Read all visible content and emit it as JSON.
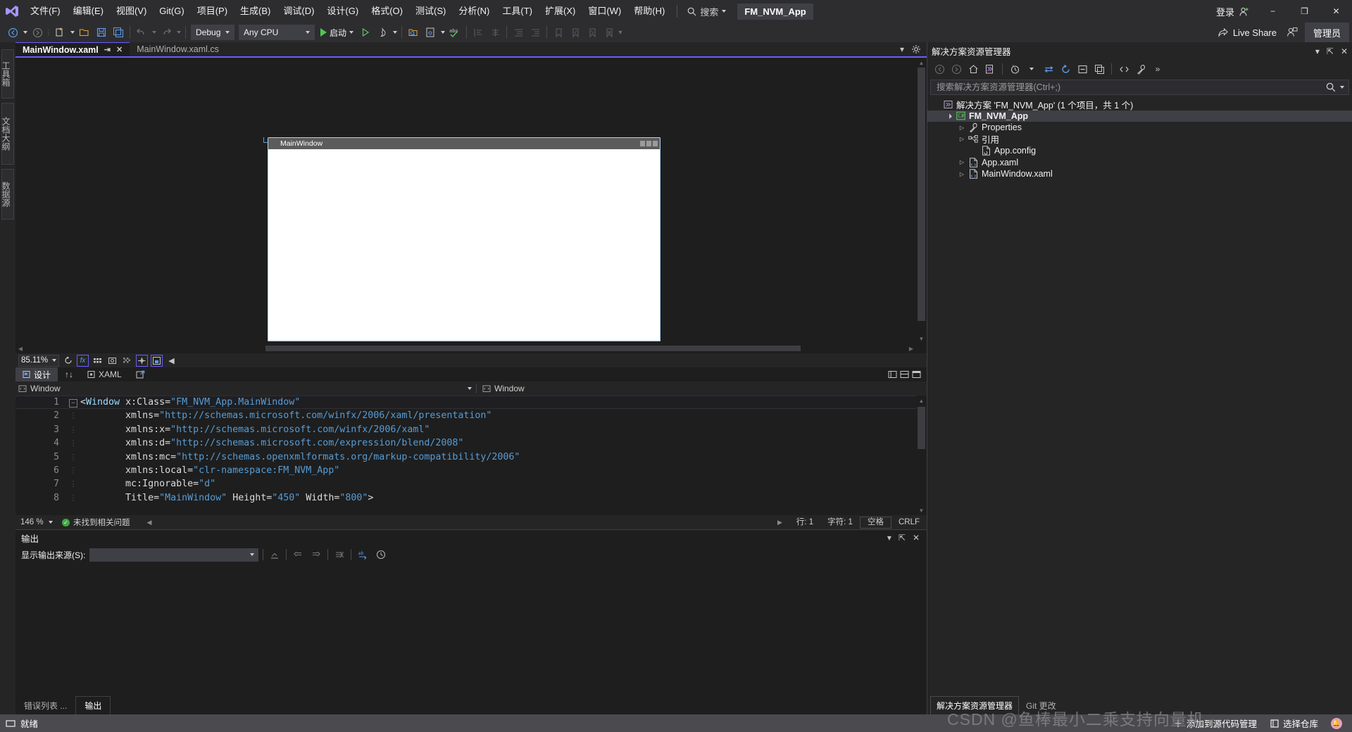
{
  "titlebar": {
    "logo": "vs-logo",
    "menus": [
      {
        "label": "文件(F)"
      },
      {
        "label": "编辑(E)"
      },
      {
        "label": "视图(V)"
      },
      {
        "label": "Git(G)"
      },
      {
        "label": "项目(P)"
      },
      {
        "label": "生成(B)"
      },
      {
        "label": "调试(D)"
      },
      {
        "label": "设计(G)"
      },
      {
        "label": "格式(O)"
      },
      {
        "label": "测试(S)"
      },
      {
        "label": "分析(N)"
      },
      {
        "label": "工具(T)"
      },
      {
        "label": "扩展(X)"
      },
      {
        "label": "窗口(W)"
      },
      {
        "label": "帮助(H)"
      }
    ],
    "search_label": "搜索",
    "project_chip": "FM_NVM_App",
    "signin_label": "登录",
    "minimize": "−",
    "maximize": "❐",
    "close": "✕"
  },
  "toolbar": {
    "config": "Debug",
    "platform": "Any CPU",
    "start_label": "启动",
    "live_share_label": "Live Share",
    "admin_label": "管理员"
  },
  "left_rail": [
    {
      "label": "工具箱"
    },
    {
      "label": "文档大纲"
    },
    {
      "label": "数据源"
    }
  ],
  "editor": {
    "tabs": [
      {
        "label": "MainWindow.xaml",
        "active": true
      },
      {
        "label": "MainWindow.xaml.cs",
        "active": false
      }
    ],
    "pin_glyph": "⇥",
    "close_glyph": "✕"
  },
  "designer": {
    "preview_title": "MainWindow",
    "zoom": "85.11%",
    "view_tabs": [
      {
        "label": "设计",
        "active": true
      },
      {
        "label": "XAML",
        "active": false
      }
    ],
    "swap_glyph": "↑↓",
    "popout_glyph": "⬈"
  },
  "code": {
    "crumb_left": "Window",
    "crumb_right": "Window",
    "zoom": "146 %",
    "issues": "未找到相关问题",
    "line_label": "行: 1",
    "char_label": "字符: 1",
    "spaces_label": "空格",
    "eol_label": "CRLF",
    "lines": [
      {
        "num": "1",
        "fold": "−",
        "indent": 0,
        "segments": [
          {
            "t": "<",
            "c": "punct"
          },
          {
            "t": "Window",
            "c": "tag"
          },
          {
            "t": " ",
            "c": "plain"
          },
          {
            "t": "x:Class",
            "c": "attr"
          },
          {
            "t": "=",
            "c": "punct"
          },
          {
            "t": "\"FM_NVM_App.MainWindow\"",
            "c": "str"
          }
        ]
      },
      {
        "num": "2",
        "fold": "",
        "indent": 8,
        "segments": [
          {
            "t": "xmlns",
            "c": "attr"
          },
          {
            "t": "=",
            "c": "punct"
          },
          {
            "t": "\"http://schemas.microsoft.com/winfx/2006/xaml/presentation\"",
            "c": "str"
          }
        ]
      },
      {
        "num": "3",
        "fold": "",
        "indent": 8,
        "segments": [
          {
            "t": "xmlns:x",
            "c": "attr"
          },
          {
            "t": "=",
            "c": "punct"
          },
          {
            "t": "\"http://schemas.microsoft.com/winfx/2006/xaml\"",
            "c": "str"
          }
        ]
      },
      {
        "num": "4",
        "fold": "",
        "indent": 8,
        "segments": [
          {
            "t": "xmlns:d",
            "c": "attr"
          },
          {
            "t": "=",
            "c": "punct"
          },
          {
            "t": "\"http://schemas.microsoft.com/expression/blend/2008\"",
            "c": "str"
          }
        ]
      },
      {
        "num": "5",
        "fold": "",
        "indent": 8,
        "segments": [
          {
            "t": "xmlns:mc",
            "c": "attr"
          },
          {
            "t": "=",
            "c": "punct"
          },
          {
            "t": "\"http://schemas.openxmlformats.org/markup-compatibility/2006\"",
            "c": "str"
          }
        ]
      },
      {
        "num": "6",
        "fold": "",
        "indent": 8,
        "segments": [
          {
            "t": "xmlns:local",
            "c": "attr"
          },
          {
            "t": "=",
            "c": "punct"
          },
          {
            "t": "\"clr-namespace:FM_NVM_App\"",
            "c": "str"
          }
        ]
      },
      {
        "num": "7",
        "fold": "",
        "indent": 8,
        "segments": [
          {
            "t": "mc:Ignorable",
            "c": "attr"
          },
          {
            "t": "=",
            "c": "punct"
          },
          {
            "t": "\"d\"",
            "c": "str"
          }
        ]
      },
      {
        "num": "8",
        "fold": "",
        "indent": 8,
        "segments": [
          {
            "t": "Title",
            "c": "attr"
          },
          {
            "t": "=",
            "c": "punct"
          },
          {
            "t": "\"MainWindow\"",
            "c": "str"
          },
          {
            "t": " ",
            "c": "plain"
          },
          {
            "t": "Height",
            "c": "attr"
          },
          {
            "t": "=",
            "c": "punct"
          },
          {
            "t": "\"450\"",
            "c": "str"
          },
          {
            "t": " ",
            "c": "plain"
          },
          {
            "t": "Width",
            "c": "attr"
          },
          {
            "t": "=",
            "c": "punct"
          },
          {
            "t": "\"800\"",
            "c": "str"
          },
          {
            "t": ">",
            "c": "punct"
          }
        ]
      }
    ]
  },
  "output": {
    "title": "输出",
    "source_label": "显示输出来源(S):",
    "source_value": "",
    "tabs": [
      {
        "label": "错误列表 ...",
        "active": false
      },
      {
        "label": "输出",
        "active": true
      }
    ]
  },
  "solution_explorer": {
    "title": "解决方案资源管理器",
    "search_placeholder": "搜索解决方案资源管理器(Ctrl+;)",
    "tree": [
      {
        "indent": 0,
        "arrow": "",
        "icon": "solution-icon",
        "label": "解决方案 'FM_NVM_App' (1 个项目，共 1 个)",
        "bold": false,
        "selected": false
      },
      {
        "indent": 1,
        "arrow": "▾",
        "icon": "csharp-project-icon",
        "label": "FM_NVM_App",
        "bold": true,
        "selected": true
      },
      {
        "indent": 2,
        "arrow": "▸",
        "icon": "wrench-icon",
        "label": "Properties",
        "bold": false,
        "selected": false
      },
      {
        "indent": 2,
        "arrow": "▸",
        "icon": "references-icon",
        "label": "引用",
        "bold": false,
        "selected": false
      },
      {
        "indent": 3,
        "arrow": "",
        "icon": "config-file-icon",
        "label": "App.config",
        "bold": false,
        "selected": false
      },
      {
        "indent": 2,
        "arrow": "▸",
        "icon": "xaml-file-icon",
        "label": "App.xaml",
        "bold": false,
        "selected": false
      },
      {
        "indent": 2,
        "arrow": "▸",
        "icon": "xaml-file-icon",
        "label": "MainWindow.xaml",
        "bold": false,
        "selected": false
      }
    ],
    "bottom_tabs": [
      {
        "label": "解决方案资源管理器",
        "active": true
      },
      {
        "label": "Git 更改",
        "active": false
      }
    ]
  },
  "statusbar": {
    "ready": "就绪",
    "add_to_source_control": "添加到源代码管理",
    "select_repo": "选择仓库"
  },
  "watermark": "CSDN @鱼棒最小二乘支持向量机",
  "colors": {
    "accent_purple": "#6b5cff",
    "status_purple": "#68217a",
    "chrome_bg": "#2d2d30",
    "editor_bg": "#1e1e1e",
    "panel_bg": "#252526",
    "green_run": "#4ec94e"
  }
}
